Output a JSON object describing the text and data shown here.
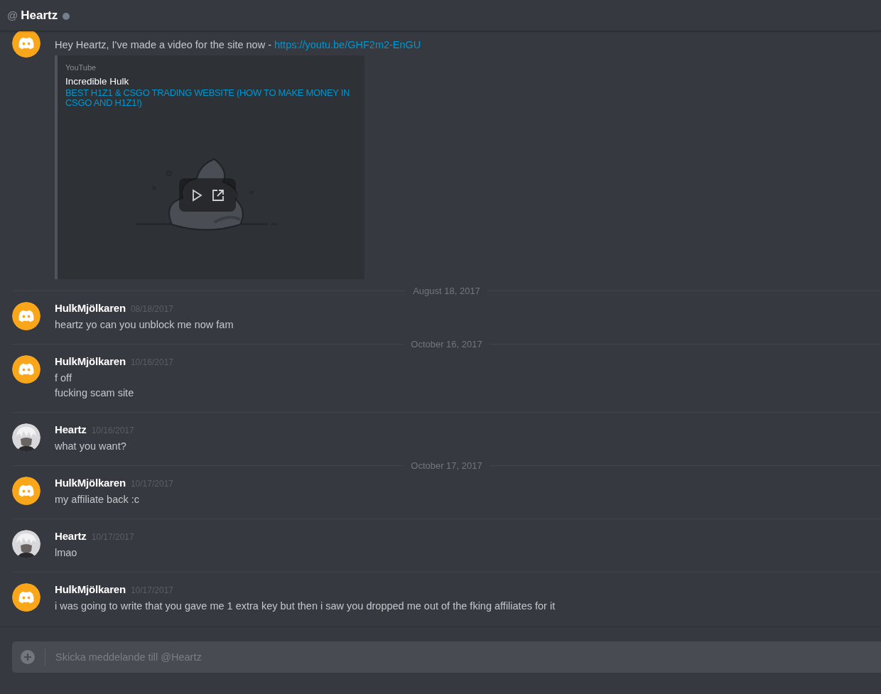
{
  "header": {
    "prefix": "@",
    "name": "Heartz",
    "online": false
  },
  "feed": [
    {
      "kind": "message",
      "default_avatar": true,
      "lines": [
        {
          "text": "Hey Heartz, I've made a video for the site now - ",
          "link": "https://youtu.be/GHF2m2-EnGU"
        }
      ],
      "embed": {
        "provider": "YouTube",
        "author": "Incredible Hulk",
        "title": "BEST H1Z1 & CSGO TRADING WEBSITE (HOW TO MAKE MONEY IN CSGO AND H1Z1!)"
      }
    },
    {
      "kind": "date",
      "label": "August 18, 2017"
    },
    {
      "kind": "message",
      "default_avatar": true,
      "author": "HulkMjölkaren",
      "time": "08/18/2017",
      "lines": [
        {
          "text": "heartz yo can you unblock me now fam"
        }
      ]
    },
    {
      "kind": "date",
      "label": "October 16, 2017"
    },
    {
      "kind": "message",
      "default_avatar": true,
      "author": "HulkMjölkaren",
      "time": "10/16/2017",
      "lines": [
        {
          "text": "f off"
        },
        {
          "text": "fucking scam site"
        }
      ]
    },
    {
      "kind": "message",
      "default_avatar": false,
      "author": "Heartz",
      "time": "10/16/2017",
      "lines": [
        {
          "text": "what you want?"
        }
      ]
    },
    {
      "kind": "date",
      "label": "October 17, 2017"
    },
    {
      "kind": "message",
      "default_avatar": true,
      "author": "HulkMjölkaren",
      "time": "10/17/2017",
      "lines": [
        {
          "text": "my affiliate back :c"
        }
      ]
    },
    {
      "kind": "message",
      "default_avatar": false,
      "author": "Heartz",
      "time": "10/17/2017",
      "lines": [
        {
          "text": "lmao"
        }
      ]
    },
    {
      "kind": "message",
      "default_avatar": true,
      "author": "HulkMjölkaren",
      "time": "10/17/2017",
      "lines": [
        {
          "text": "i was going to write that you gave me 1 extra key but then i saw you dropped me out of the fking affiliates for it"
        }
      ]
    }
  ],
  "composer": {
    "placeholder": "Skicka meddelande till @Heartz"
  }
}
